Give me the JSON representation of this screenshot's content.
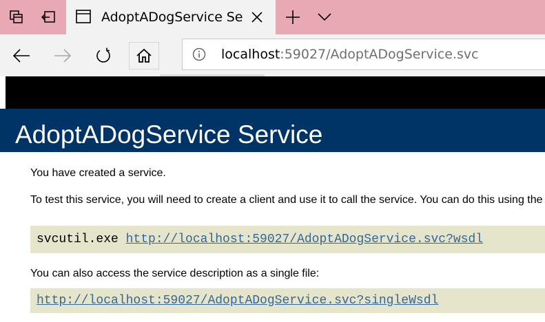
{
  "browser": {
    "tab": {
      "title": "AdoptADogService Service"
    },
    "address": {
      "host": "localhost",
      "rest": ":59027/AdoptADogService.svc"
    }
  },
  "page": {
    "heading": "AdoptADogService Service",
    "intro": "You have created a service.",
    "test_instructions": "To test this service, you will need to create a client and use it to call the service. You can do this using the svcutil.exe tool from the command line with the following syntax:",
    "svcutil": {
      "command": "svcutil.exe ",
      "wsdl_link": "http://localhost:59027/AdoptADogService.svc?wsdl"
    },
    "single_file_text": "You can also access the service description as a single file:",
    "single_wsdl_link": "http://localhost:59027/AdoptADogService.svc?singleWsdl"
  },
  "colors": {
    "tabstrip": "#e8a9b4",
    "heading_bg": "#003366",
    "code_bg": "#e5e5cc",
    "link": "#336699"
  },
  "icons": [
    "tab-actions-icon",
    "set-aside-tabs-icon",
    "page-favicon-icon",
    "close-icon",
    "plus-icon",
    "chevron-down-icon",
    "back-arrow-icon",
    "forward-arrow-icon",
    "refresh-icon",
    "home-icon",
    "info-icon"
  ]
}
